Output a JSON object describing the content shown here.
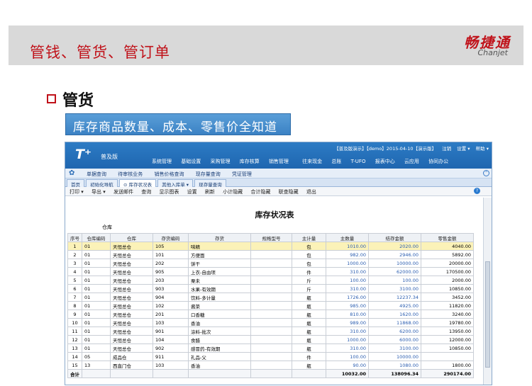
{
  "slide": {
    "title": "管钱、管货、管订单",
    "logo_cn": "畅捷通",
    "logo_en": "Chanjet",
    "section_title": "管货",
    "callout": "库存商品数量、成本、零售价全知道"
  },
  "app": {
    "logo": "T⁺",
    "edition": "普及版",
    "status_items": [
      "【普及版演示】【demo】2015-04-10【演示版】",
      "注销",
      "设置 ▾",
      "帮助 ▾"
    ],
    "top_menu": [
      "系统管理",
      "基础设置",
      "采购管理",
      "库存核算",
      "销售管理",
      "往来现金",
      "总账",
      "T-UFO",
      "报表中心",
      "云应用",
      "协同办公"
    ],
    "nav_items": [
      "单据查询",
      "待审核业务",
      "销售价格查询",
      "现存量查询",
      "凭证管理"
    ],
    "tabs": [
      "首页",
      "初始化导航",
      "库存状况表",
      "其他入库单 ▾",
      "现存量查询"
    ],
    "toolbar": [
      "打印 ▾",
      "导出 ▾",
      "发送邮件",
      "查询",
      "显示图表",
      "设置",
      "刷新",
      "小计隐藏",
      "合计隐藏",
      "联查隐藏",
      "退出"
    ],
    "report_title": "库存状况表",
    "warehouse_label": "仓库",
    "columns": [
      "序号",
      "仓库编码",
      "仓库",
      "存货编码",
      "存货",
      "规格型号",
      "主计量",
      "主数量",
      "结存金额",
      "零售金额"
    ],
    "rows": [
      [
        "1",
        "01",
        "天恒总仓",
        "105",
        "味精",
        "",
        "包",
        "1010.00",
        "2020.00",
        "4040.00"
      ],
      [
        "2",
        "01",
        "天恒总仓",
        "101",
        "方便面",
        "",
        "包",
        "982.00",
        "2946.00",
        "5892.00"
      ],
      [
        "3",
        "01",
        "天恒总仓",
        "202",
        "饼干",
        "",
        "包",
        "1000.00",
        "10000.00",
        "20000.00"
      ],
      [
        "4",
        "01",
        "天恒总仓",
        "905",
        "上衣-自由项",
        "",
        "件",
        "310.00",
        "62000.00",
        "170500.00"
      ],
      [
        "5",
        "01",
        "天恒总仓",
        "203",
        "栗未",
        "",
        "斤",
        "100.00",
        "100.00",
        "2000.00"
      ],
      [
        "6",
        "01",
        "天恒总仓",
        "903",
        "水果-有效期",
        "",
        "斤",
        "310.00",
        "3100.00",
        "10850.00"
      ],
      [
        "7",
        "01",
        "天恒总仓",
        "904",
        "饮料-多计量",
        "",
        "瓶",
        "1726.00",
        "12237.34",
        "3452.00"
      ],
      [
        "8",
        "01",
        "天恒总仓",
        "102",
        "酱菜",
        "",
        "瓶",
        "985.00",
        "4925.00",
        "11820.00"
      ],
      [
        "9",
        "01",
        "天恒总仓",
        "201",
        "口香糖",
        "",
        "瓶",
        "810.00",
        "1620.00",
        "3240.00"
      ],
      [
        "10",
        "01",
        "天恒总仓",
        "103",
        "香油",
        "",
        "瓶",
        "989.00",
        "11868.00",
        "19780.00"
      ],
      [
        "11",
        "01",
        "天恒总仓",
        "901",
        "涂料-批次",
        "",
        "瓶",
        "310.00",
        "6200.00",
        "13950.00"
      ],
      [
        "12",
        "01",
        "天恒总仓",
        "104",
        "食醋",
        "",
        "瓶",
        "1000.00",
        "6000.00",
        "12000.00"
      ],
      [
        "13",
        "01",
        "天恒总仓",
        "902",
        "感冒药-有效期",
        "",
        "瓶",
        "310.00",
        "3100.00",
        "10850.00"
      ],
      [
        "14",
        "05",
        "成品仓",
        "911",
        "礼品-父",
        "",
        "件",
        "100.00",
        "10000.00",
        ""
      ],
      [
        "15",
        "13",
        "西直门仓",
        "103",
        "香油",
        "",
        "瓶",
        "90.00",
        "1080.00",
        "1800.00"
      ]
    ],
    "total": {
      "label": "合计",
      "qty": "10032.00",
      "cost": "138096.34",
      "retail": "290174.00"
    }
  }
}
